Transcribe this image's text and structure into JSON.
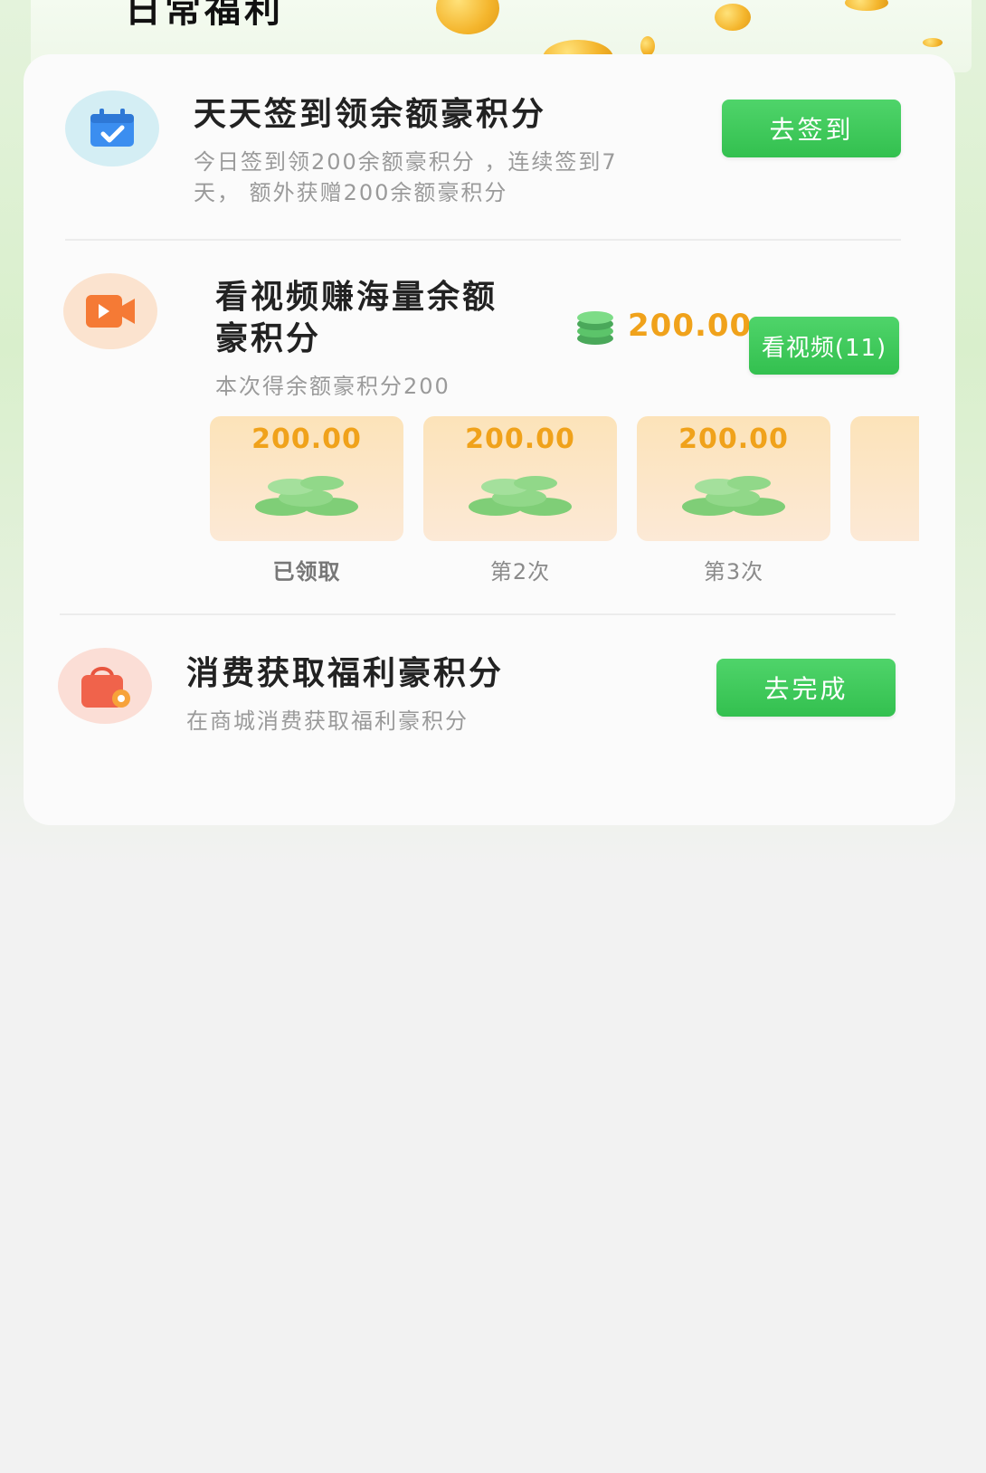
{
  "section": {
    "title": "日常福利"
  },
  "tasks": [
    {
      "title": "天天签到领余额豪积分",
      "subtitle_line1": "今日签到领200余额豪积分 ，连续签到7",
      "subtitle_line2": "天， 额外获赠200余额豪积分",
      "button": "去签到",
      "icon": "calendar-check-icon"
    },
    {
      "title_line1": "看视频赚海量余额",
      "title_line2": "豪积分",
      "subtitle": "本次得余额豪积分200",
      "reward_amount": "200.00",
      "button": "看视频(11)",
      "icon": "video-camera-icon",
      "rewards": [
        {
          "value": "200.00",
          "label": "已领取"
        },
        {
          "value": "200.00",
          "label": "第2次"
        },
        {
          "value": "200.00",
          "label": "第3次"
        }
      ]
    },
    {
      "title": "消费获取福利豪积分",
      "subtitle": "在商城消费获取福利豪积分",
      "button": "去完成",
      "icon": "shopping-bag-icon"
    }
  ],
  "colors": {
    "accent_green": "#3cc759",
    "reward_orange": "#f0a21b",
    "coin_green": "#5cc46a"
  }
}
